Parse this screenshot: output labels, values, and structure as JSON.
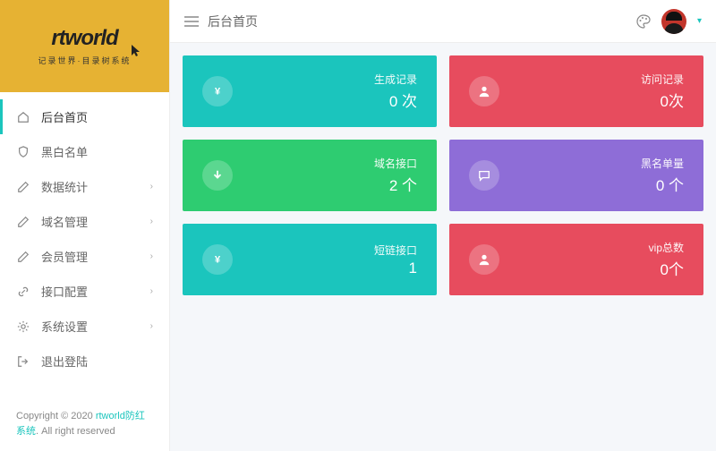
{
  "logo": {
    "main": "rtworld",
    "sub": "记录世界·目录树系统"
  },
  "nav": [
    {
      "label": "后台首页",
      "icon": "home",
      "active": true,
      "sub": false
    },
    {
      "label": "黑白名单",
      "icon": "shield",
      "active": false,
      "sub": false
    },
    {
      "label": "数据统计",
      "icon": "pencil",
      "active": false,
      "sub": true
    },
    {
      "label": "域名管理",
      "icon": "pencil",
      "active": false,
      "sub": true
    },
    {
      "label": "会员管理",
      "icon": "pencil",
      "active": false,
      "sub": true
    },
    {
      "label": "接口配置",
      "icon": "link",
      "active": false,
      "sub": true
    },
    {
      "label": "系统设置",
      "icon": "gear",
      "active": false,
      "sub": true
    },
    {
      "label": "退出登陆",
      "icon": "exit",
      "active": false,
      "sub": false
    }
  ],
  "header": {
    "title": "后台首页"
  },
  "cards": [
    {
      "icon": "yen",
      "label": "生成记录",
      "value": "0 次",
      "color": "teal"
    },
    {
      "icon": "user",
      "label": "访问记录",
      "value": "0次",
      "color": "red"
    },
    {
      "icon": "down",
      "label": "域名接口",
      "value": "2 个",
      "color": "green"
    },
    {
      "icon": "chat",
      "label": "黑名单量",
      "value": "0 个",
      "color": "purple"
    },
    {
      "icon": "yen",
      "label": "短链接口",
      "value": "1",
      "color": "teal"
    },
    {
      "icon": "user",
      "label": "vip总数",
      "value": "0个",
      "color": "red"
    }
  ],
  "footer": {
    "pre": "Copyright © 2020 ",
    "link": "rtworld防红系统",
    "post": ". All right reserved"
  }
}
